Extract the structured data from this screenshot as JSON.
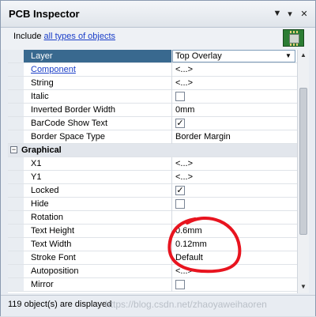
{
  "window": {
    "title": "PCB Inspector"
  },
  "include": {
    "prefix": "Include",
    "link": "all types of objects"
  },
  "properties": {
    "top_rows": [
      {
        "name": "Layer",
        "value": "Top Overlay",
        "kind": "dropdown",
        "selected": true
      },
      {
        "name": "Component",
        "value": "<...>",
        "kind": "text",
        "link": true
      },
      {
        "name": "String",
        "value": "<...>",
        "kind": "text"
      },
      {
        "name": "Italic",
        "value": "",
        "kind": "checkbox",
        "checked": false
      },
      {
        "name": "Inverted Border Width",
        "value": "0mm",
        "kind": "text"
      },
      {
        "name": "BarCode Show Text",
        "value": "",
        "kind": "checkbox",
        "checked": true
      },
      {
        "name": "Border Space Type",
        "value": "Border Margin",
        "kind": "text"
      }
    ],
    "category": {
      "name": "Graphical",
      "expander": "−"
    },
    "graphical_rows": [
      {
        "name": "X1",
        "value": "<...>",
        "kind": "text"
      },
      {
        "name": "Y1",
        "value": "<...>",
        "kind": "text"
      },
      {
        "name": "Locked",
        "value": "",
        "kind": "checkbox",
        "checked": true
      },
      {
        "name": "Hide",
        "value": "",
        "kind": "checkbox",
        "checked": false
      },
      {
        "name": "Rotation",
        "value": "",
        "kind": "text"
      },
      {
        "name": "Text Height",
        "value": "0.6mm",
        "kind": "text"
      },
      {
        "name": "Text Width",
        "value": "0.12mm",
        "kind": "text"
      },
      {
        "name": "Stroke Font",
        "value": "Default",
        "kind": "text"
      },
      {
        "name": "Autoposition",
        "value": "<...>",
        "kind": "text"
      },
      {
        "name": "Mirror",
        "value": "",
        "kind": "checkbox",
        "checked": false
      }
    ]
  },
  "checkmark": "✓",
  "status": {
    "text": "119 object(s) are displayed",
    "watermark": "https://blog.csdn.net/zhaoyaweihaoren"
  },
  "icons": {
    "dropdown_arrow": "▼",
    "minimize": "▼",
    "pin": "▾",
    "close": "✕",
    "scroll_up": "▲",
    "scroll_down": "▼"
  },
  "colors": {
    "selection": "#39698f",
    "link": "#1a3ec8",
    "annotation": "#e8141f"
  }
}
